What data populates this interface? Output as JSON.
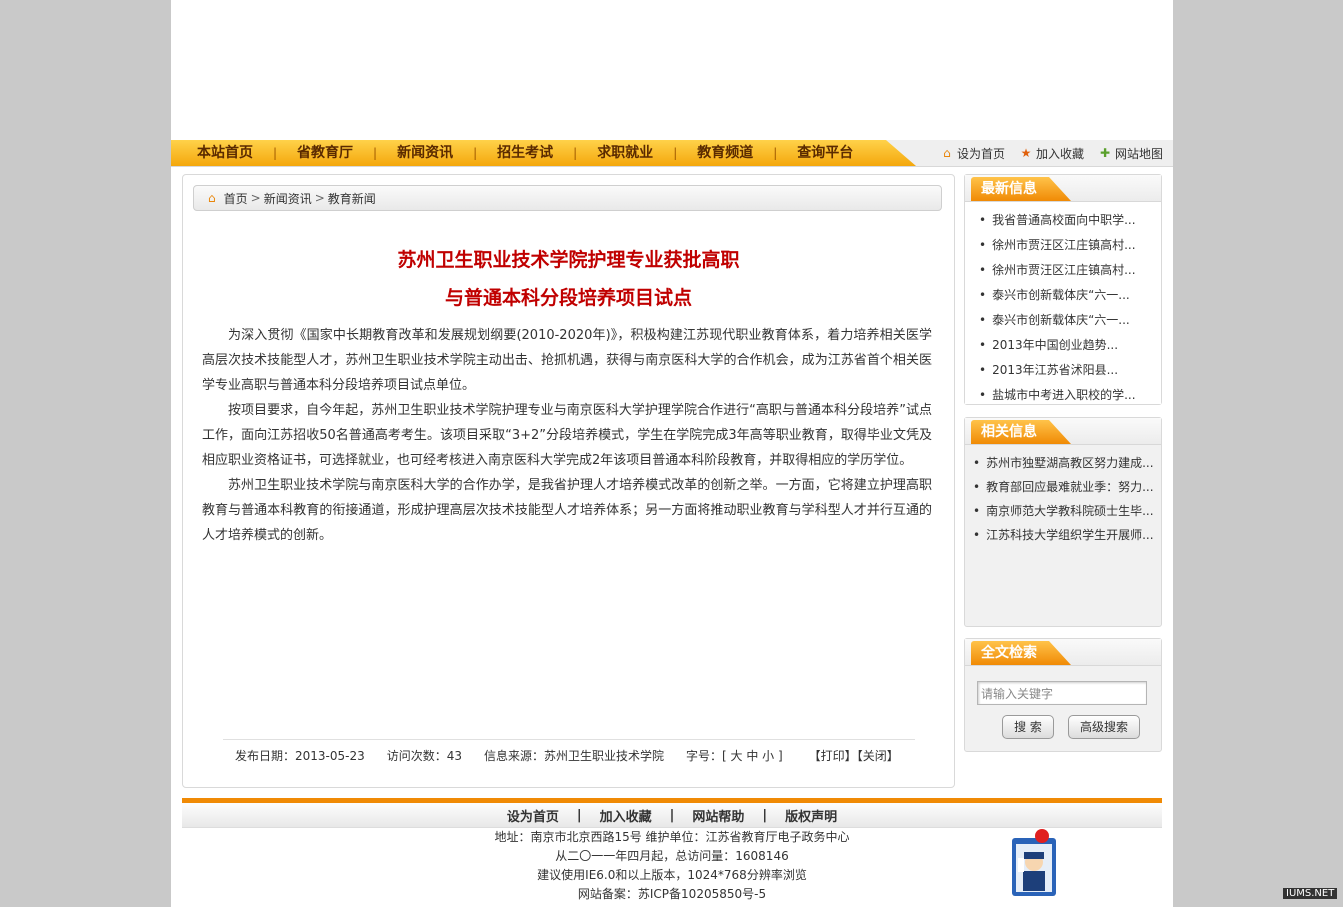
{
  "nav": {
    "items": [
      "本站首页",
      "省教育厅",
      "新闻资讯",
      "招生考试",
      "求职就业",
      "教育频道",
      "查询平台"
    ],
    "separator": "|",
    "links": [
      {
        "icon": "home-icon",
        "label": "设为首页"
      },
      {
        "icon": "star-icon",
        "label": "加入收藏"
      },
      {
        "icon": "map-icon",
        "label": "网站地图"
      }
    ]
  },
  "breadcrumb": {
    "home": "首页",
    "sep": ">",
    "level1": "新闻资讯",
    "level2": "教育新闻"
  },
  "article": {
    "title_line1": "苏州卫生职业技术学院护理专业获批高职",
    "title_line2": "与普通本科分段培养项目试点",
    "paragraphs": [
      "为深入贯彻《国家中长期教育改革和发展规划纲要(2010-2020年)》，积极构建江苏现代职业教育体系，着力培养相关医学高层次技术技能型人才，苏州卫生职业技术学院主动出击、抢抓机遇，获得与南京医科大学的合作机会，成为江苏省首个相关医学专业高职与普通本科分段培养项目试点单位。",
      "按项目要求，自今年起，苏州卫生职业技术学院护理专业与南京医科大学护理学院合作进行“高职与普通本科分段培养”试点工作，面向江苏招收50名普通高考考生。该项目采取“3+2”分段培养模式，学生在学院完成3年高等职业教育，取得毕业文凭及相应职业资格证书，可选择就业，也可经考核进入南京医科大学完成2年该项目普通本科阶段教育，并取得相应的学历学位。",
      "苏州卫生职业技术学院与南京医科大学的合作办学，是我省护理人才培养模式改革的创新之举。一方面，它将建立护理高职教育与普通本科教育的衔接通道，形成护理高层次技术技能型人才培养体系；另一方面将推动职业教育与学科型人才并行互通的人才培养模式的创新。"
    ],
    "meta": {
      "date": "发布日期：2013-05-23",
      "visits": "访问次数：43",
      "source": "信息来源：苏州卫生职业技术学院",
      "fontsize": "字号：[ 大 中 小 ]",
      "print": "【打印】",
      "close": "【关闭】"
    }
  },
  "sidebar": {
    "latest": {
      "title": "最新信息",
      "items": [
        "我省普通高校面向中职学...",
        "徐州市贾汪区江庄镇高村...",
        "徐州市贾汪区江庄镇高村...",
        "泰兴市创新载体庆“六一...",
        "泰兴市创新载体庆“六一...",
        "2013年中国创业趋势...",
        "2013年江苏省沭阳县...",
        "盐城市中考进入职校的学..."
      ]
    },
    "related": {
      "title": "相关信息",
      "items": [
        "苏州市独墅湖高教区努力建成...",
        "教育部回应最难就业季：努力...",
        "南京师范大学教科院硕士生毕...",
        "江苏科技大学组织学生开展师..."
      ]
    },
    "search": {
      "title": "全文检索",
      "placeholder": "请输入关键字",
      "search_btn": "搜 索",
      "advanced_btn": "高级搜索"
    }
  },
  "footer": {
    "links": [
      "设为首页",
      "加入收藏",
      "网站帮助",
      "版权声明"
    ],
    "sep": "|",
    "address": "地址：南京市北京西路15号 维护单位：江苏省教育厅电子政务中心",
    "counter": "从二〇一一年四月起，总访问量：1608146",
    "browser": "建议使用IE6.0和以上版本，1024*768分辨率浏览",
    "icp": "网站备案：苏ICP备10205850号-5"
  },
  "watermark": "IUMS.NET"
}
